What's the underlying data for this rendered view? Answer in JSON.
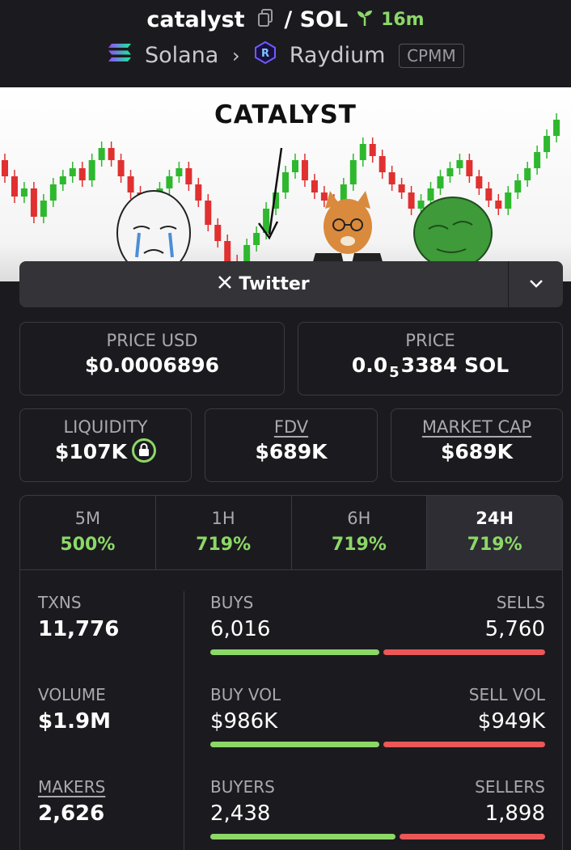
{
  "header": {
    "token": "catalyst",
    "pair_sep": "/ SOL",
    "age": "16m",
    "chain": "Solana",
    "dex": "Raydium",
    "pool_type": "CPMM"
  },
  "banner": {
    "title": "CATALYST"
  },
  "social": {
    "twitter_label": "Twitter"
  },
  "price": {
    "usd_label": "PRICE USD",
    "usd_value": "$0.0006896",
    "native_label": "PRICE",
    "native_prefix": "0.0",
    "native_sub": "5",
    "native_suffix": "3384 SOL"
  },
  "metrics": {
    "liquidity_label": "LIQUIDITY",
    "liquidity_value": "$107K",
    "fdv_label": "FDV",
    "fdv_value": "$689K",
    "mcap_label": "MARKET CAP",
    "mcap_value": "$689K"
  },
  "tabs": [
    {
      "label": "5M",
      "value": "500%"
    },
    {
      "label": "1H",
      "value": "719%"
    },
    {
      "label": "6H",
      "value": "719%"
    },
    {
      "label": "24H",
      "value": "719%"
    }
  ],
  "stats": {
    "txns_label": "TXNS",
    "txns_value": "11,776",
    "buys_label": "BUYS",
    "buys_value": "6,016",
    "sells_label": "SELLS",
    "sells_value": "5,760",
    "txns_buy_ratio": 0.51,
    "volume_label": "VOLUME",
    "volume_value": "$1.9M",
    "buyvol_label": "BUY VOL",
    "buyvol_value": "$986K",
    "sellvol_label": "SELL VOL",
    "sellvol_value": "$949K",
    "volume_buy_ratio": 0.51,
    "makers_label": "MAKERS",
    "makers_value": "2,626",
    "buyers_label": "BUYERS",
    "buyers_value": "2,438",
    "sellers_label": "SELLERS",
    "sellers_value": "1,898",
    "makers_buy_ratio": 0.56
  },
  "colors": {
    "green": "#8cd867",
    "red": "#eb5757",
    "bg": "#1b1b1f"
  }
}
